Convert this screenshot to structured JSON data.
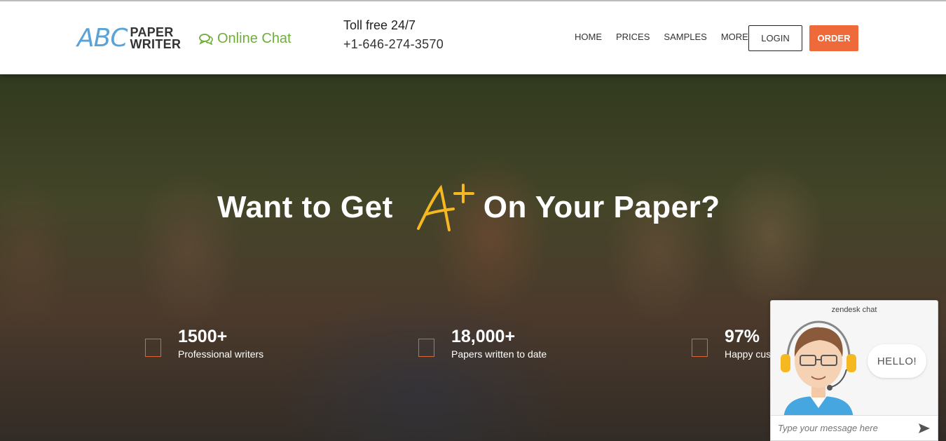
{
  "header": {
    "logo": {
      "abc": "ABC",
      "line1": "PAPER",
      "line2": "WRITER"
    },
    "chat_link": {
      "label": "Online Chat",
      "icon": "chat-bubbles-icon"
    },
    "toll": {
      "label": "Toll free 24/7",
      "phone": "+1-646-274-3570"
    },
    "nav": [
      {
        "label": "HOME"
      },
      {
        "label": "PRICES"
      },
      {
        "label": "SAMPLES"
      },
      {
        "label": "MORE"
      }
    ],
    "login_label": "LOGIN",
    "order_label": "ORDER"
  },
  "hero": {
    "headline_left": "Want to Get",
    "headline_right": "On Your Paper?",
    "stats": [
      {
        "value": "1500+",
        "label": "Professional writers"
      },
      {
        "value": "18,000+",
        "label": "Papers written to date"
      },
      {
        "value": "97%",
        "label": "Happy cus"
      }
    ]
  },
  "chat_widget": {
    "title": "zendesk chat",
    "greeting": "HELLO!",
    "input_placeholder": "Type your message here"
  },
  "colors": {
    "accent_orange": "#ef6a3a",
    "chat_green": "#6fae3c",
    "logo_blue": "#5aa3d8",
    "aplus_yellow": "#f5b820"
  }
}
